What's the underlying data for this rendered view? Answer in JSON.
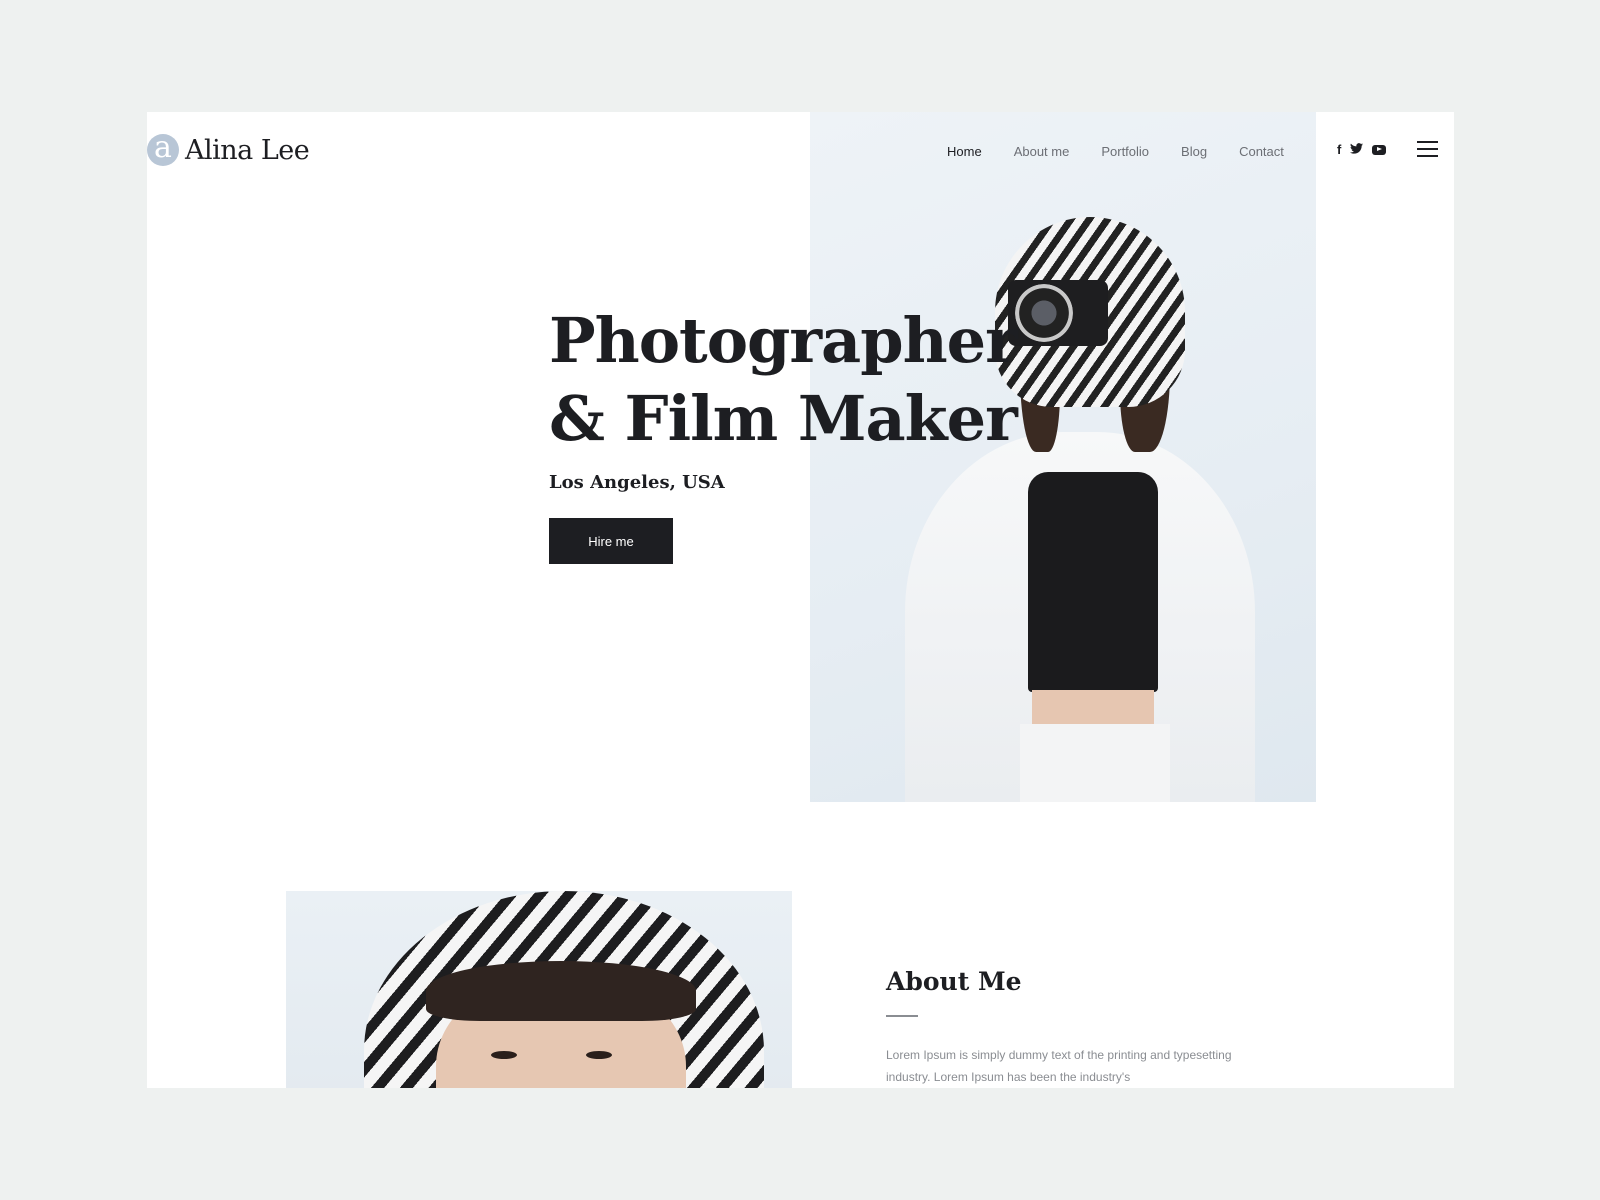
{
  "header": {
    "logo_mark": "a",
    "logo_text": "Alina Lee",
    "nav": [
      "Home",
      "About me",
      "Portfolio",
      "Blog",
      "Contact"
    ],
    "active_nav": "Home",
    "social": [
      "facebook-icon",
      "twitter-icon",
      "youtube-icon"
    ]
  },
  "hero": {
    "title_line1": "Photographer",
    "title_line2": "& Film Maker",
    "location": "Los Angeles, USA",
    "cta_label": "Hire me"
  },
  "about": {
    "title": "About Me",
    "text": "Lorem Ipsum is simply dummy text of the printing and typesetting industry. Lorem Ipsum has been the industry's"
  },
  "colors": {
    "background": "#eef1f0",
    "text": "#1d1e22",
    "muted": "#8a8d92",
    "logo_mark": "#b8c6d6"
  }
}
